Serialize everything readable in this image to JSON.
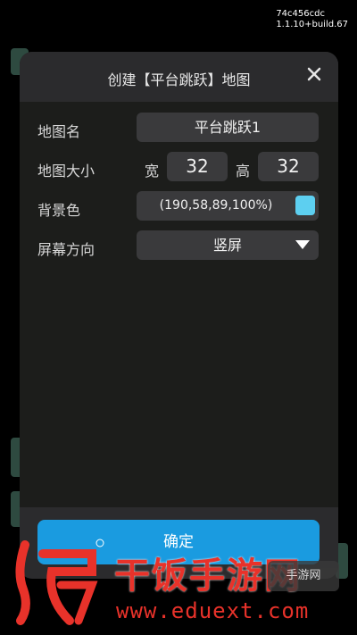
{
  "build_info": {
    "hash": "74c456cdc",
    "version": "1.1.10+build.67"
  },
  "dialog": {
    "title": "创建【平台跳跃】地图",
    "rows": {
      "map_name": {
        "label": "地图名",
        "value": "平台跳跃1"
      },
      "map_size": {
        "label": "地图大小",
        "width_label": "宽",
        "width_value": "32",
        "height_label": "高",
        "height_value": "32"
      },
      "bg_color": {
        "label": "背景色",
        "value": "(190,58,89,100%)",
        "swatch_color": "#5dcff0"
      },
      "orientation": {
        "label": "屏幕方向",
        "value": "竖屏"
      }
    },
    "confirm_label": "确定"
  },
  "watermark": {
    "title": "干饭手游网",
    "url": "www.eduext.com",
    "badge": "手游网"
  },
  "colors": {
    "accent": "#1a9be0",
    "watermark": "#e8322a"
  }
}
